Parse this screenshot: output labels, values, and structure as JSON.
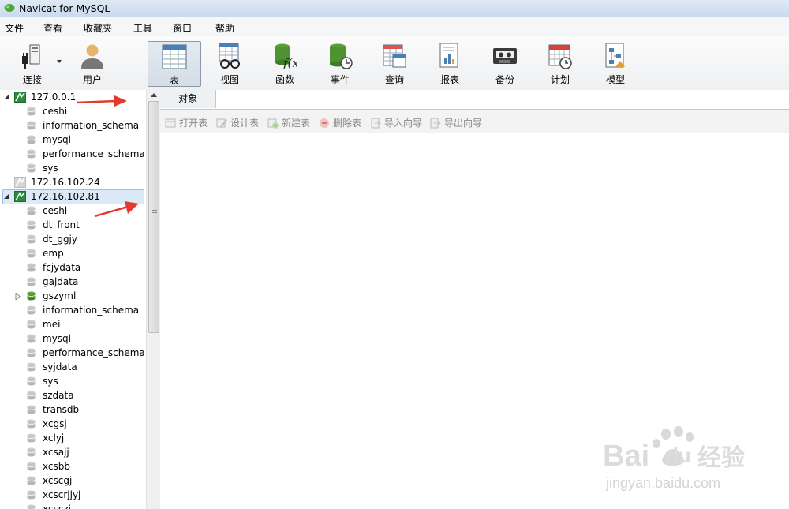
{
  "app": {
    "title": "Navicat for MySQL"
  },
  "menu": [
    "文件",
    "查看",
    "收藏夹",
    "工具",
    "窗口",
    "帮助"
  ],
  "toolbar": {
    "left": [
      {
        "label": "连接",
        "icon": "plug-icon"
      },
      {
        "label": "用户",
        "icon": "user-icon"
      }
    ],
    "right": [
      {
        "label": "表",
        "icon": "table-icon",
        "active": true
      },
      {
        "label": "视图",
        "icon": "view-icon"
      },
      {
        "label": "函数",
        "icon": "function-icon"
      },
      {
        "label": "事件",
        "icon": "event-icon"
      },
      {
        "label": "查询",
        "icon": "query-icon"
      },
      {
        "label": "报表",
        "icon": "report-icon"
      },
      {
        "label": "备份",
        "icon": "backup-icon"
      },
      {
        "label": "计划",
        "icon": "schedule-icon"
      },
      {
        "label": "模型",
        "icon": "model-icon"
      }
    ]
  },
  "tree": {
    "connections": [
      {
        "name": "127.0.0.1",
        "expanded": true,
        "selected": false,
        "databases": [
          "ceshi",
          "information_schema",
          "mysql",
          "performance_schema",
          "sys"
        ]
      },
      {
        "name": "172.16.102.24",
        "expanded": false,
        "selected": false,
        "databases": []
      },
      {
        "name": "172.16.102.81",
        "expanded": true,
        "selected": true,
        "databases": [
          "ceshi",
          "dt_front",
          "dt_ggjy",
          "emp",
          "fcjydata",
          "gajdata",
          "gszyml",
          "information_schema",
          "mei",
          "mysql",
          "performance_schema",
          "syjdata",
          "sys",
          "szdata",
          "transdb",
          "xcgsj",
          "xclyj",
          "xcsajj",
          "xcsbb",
          "xcscgj",
          "xcscrjjyj",
          "xcsczj"
        ],
        "opened": "gszyml"
      }
    ]
  },
  "main": {
    "tab": "对象",
    "actions": [
      "打开表",
      "设计表",
      "新建表",
      "删除表",
      "导入向导",
      "导出向导"
    ]
  },
  "watermark": {
    "brand": "Bai",
    "brand2": "du",
    "cn": "经验",
    "url": "jingyan.baidu.com"
  },
  "colors": {
    "accent": "#2e8b3d",
    "arrow": "#e23a2c",
    "selection": "#dceaf8"
  }
}
